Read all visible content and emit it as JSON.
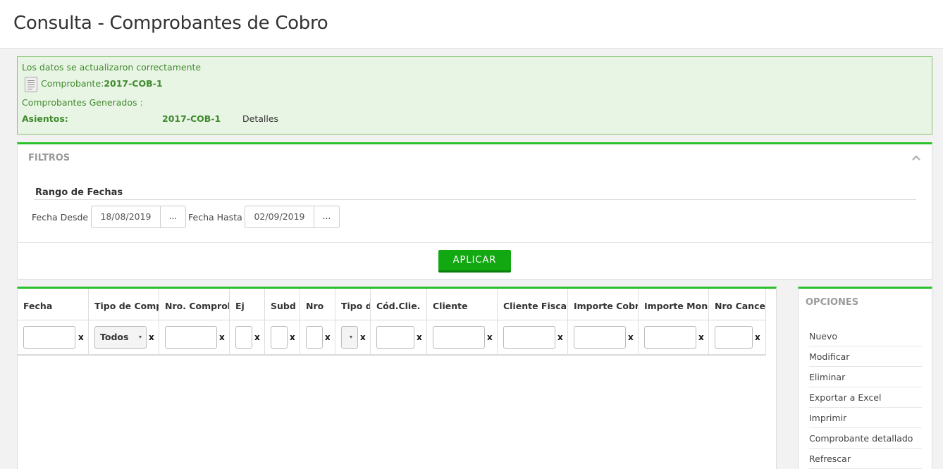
{
  "page": {
    "title": "Consulta - Comprobantes de Cobro"
  },
  "alert": {
    "message": "Los datos se actualizaron correctamente",
    "comprobante_label": "Comprobante:",
    "comprobante_value": "2017-COB-1",
    "generados_label": "Comprobantes Generados :",
    "asientos_label": "Asientos:",
    "asientos_value": "2017-COB-1",
    "detalles_link": "Detalles"
  },
  "filtros": {
    "title": "FILTROS",
    "rango_title": "Rango de Fechas",
    "desde_label": "Fecha Desde",
    "desde_value": "18/08/2019",
    "hasta_label": "Fecha Hasta",
    "hasta_value": "02/09/2019",
    "picker_label": "...",
    "apply_label": "APLICAR"
  },
  "grid": {
    "columns": [
      "Fecha",
      "Tipo de Comp",
      "Nro. Comprob",
      "Ej",
      "Subd",
      "Nro",
      "Tipo d",
      "Cód.Clie.",
      "Cliente",
      "Cliente Fiscal",
      "Importe Cobra",
      "Importe Mone",
      "Nro Cancel"
    ],
    "clear_label": "x",
    "tipo_select_value": "Todos",
    "select_arrow": "▾"
  },
  "opciones": {
    "title": "OPCIONES",
    "items": [
      "Nuevo",
      "Modificar",
      "Eliminar",
      "Exportar a Excel",
      "Imprimir",
      "Comprobante detallado",
      "Refrescar"
    ]
  },
  "colors": {
    "accent_green": "#2ac12a",
    "button_green": "#12a812",
    "alert_bg": "#e9f5e4",
    "alert_text": "#3f8a2e"
  }
}
